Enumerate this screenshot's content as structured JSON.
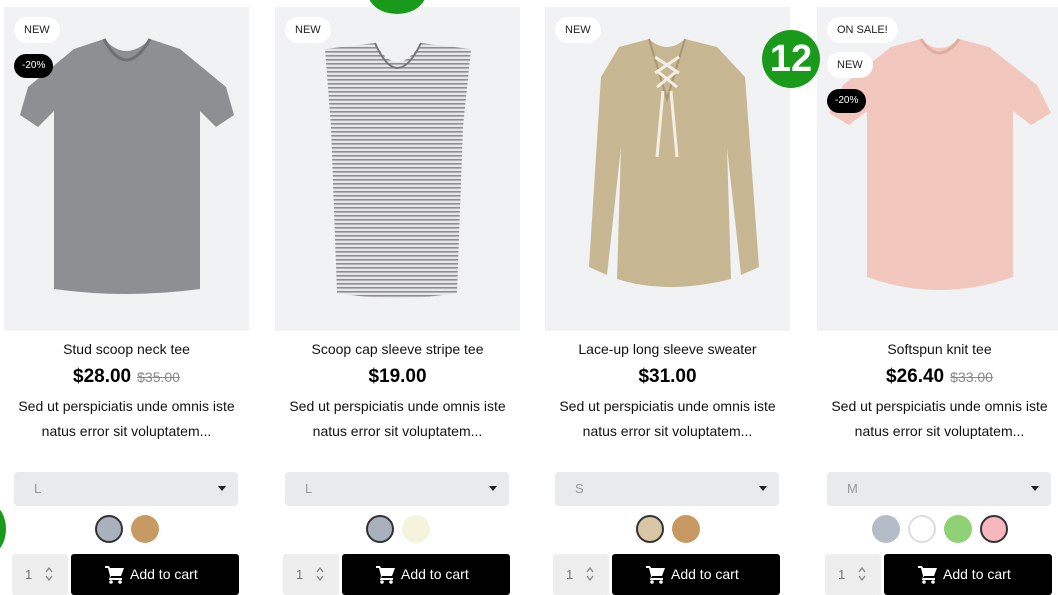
{
  "products": [
    {
      "badges": {
        "primary": "NEW",
        "discount": "-20%"
      },
      "title": "Stud scoop neck tee",
      "price": "$28.00",
      "old_price": "$35.00",
      "description": "Sed ut perspiciatis unde omnis iste natus error sit voluptatem...",
      "size": "L",
      "swatches": [
        "#a9b1bd",
        "#c79a64"
      ],
      "qty": "1",
      "cart_label": "Add to cart"
    },
    {
      "badges": {
        "primary": "NEW"
      },
      "title": "Scoop cap sleeve stripe tee",
      "price": "$19.00",
      "description": "Sed ut perspiciatis unde omnis iste natus error sit voluptatem...",
      "size": "L",
      "swatches": [
        "#a9b1bd",
        "#f5f3dc"
      ],
      "qty": "1",
      "cart_label": "Add to cart"
    },
    {
      "badges": {
        "primary": "NEW"
      },
      "title": "Lace-up long sleeve sweater",
      "price": "$31.00",
      "description": "Sed ut perspiciatis unde omnis iste natus error sit voluptatem...",
      "size": "S",
      "swatches": [
        "#d8c6a4",
        "#c79a64"
      ],
      "qty": "1",
      "cart_label": "Add to cart"
    },
    {
      "badges": {
        "primary": "ON SALE!",
        "secondary": "NEW",
        "discount": "-20%"
      },
      "title": "Softspun knit tee",
      "price": "$26.40",
      "old_price": "$33.00",
      "description": "Sed ut perspiciatis unde omnis iste natus error sit voluptatem...",
      "size": "M",
      "swatches": [
        "#b4bcc8",
        "#ffffff",
        "#8fd174",
        "#f7b7bf"
      ],
      "qty": "1",
      "cart_label": "Add to cart"
    }
  ],
  "marker": {
    "number": "12",
    "color": "#1a9a1a"
  }
}
